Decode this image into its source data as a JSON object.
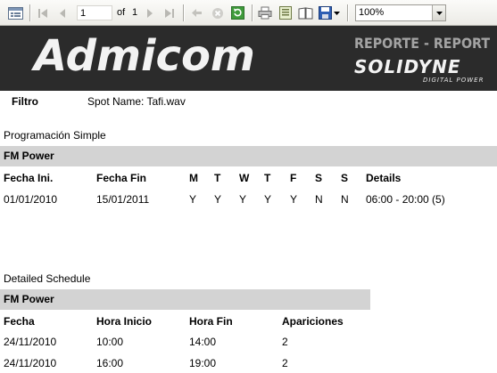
{
  "toolbar": {
    "page_current": "1",
    "page_of_label": "of",
    "page_total": "1",
    "zoom": "100%",
    "icons": [
      "toggle-tree-icon",
      "first-page-icon",
      "previous-page-icon",
      "next-page-icon",
      "last-page-icon",
      "back-icon",
      "stop-icon",
      "refresh-icon",
      "print-icon",
      "print-layout-icon",
      "page-setup-icon",
      "export-icon",
      "export-dropdown-icon",
      "zoom-dropdown-icon"
    ]
  },
  "header": {
    "brand": "Admicom",
    "report_title": "REPORTE - REPORT",
    "company": "SOLIDYNE",
    "company_tagline": "DIGITAL POWER"
  },
  "filter": {
    "label": "Filtro",
    "value": "Spot Name: Tafi.wav"
  },
  "simple": {
    "section_title": "Programación Simple",
    "group": "FM Power",
    "columns": [
      "Fecha Ini.",
      "Fecha Fin",
      "M",
      "T",
      "W",
      "T",
      "F",
      "S",
      "S",
      "Details"
    ],
    "rows": [
      [
        "01/01/2010",
        "15/01/2011",
        "Y",
        "Y",
        "Y",
        "Y",
        "Y",
        "N",
        "N",
        "06:00 - 20:00 (5)"
      ]
    ]
  },
  "detailed": {
    "section_title": "Detailed Schedule",
    "group": "FM Power",
    "columns": [
      "Fecha",
      "Hora Inicio",
      "Hora Fin",
      "Apariciones"
    ],
    "rows": [
      [
        "24/11/2010",
        "10:00",
        "14:00",
        "2"
      ],
      [
        "24/11/2010",
        "16:00",
        "19:00",
        "2"
      ]
    ]
  },
  "colors": {
    "banner_bg": "#2b2b2b",
    "group_bar": "#d3d3d3",
    "report_title": "#a3a3a3"
  }
}
